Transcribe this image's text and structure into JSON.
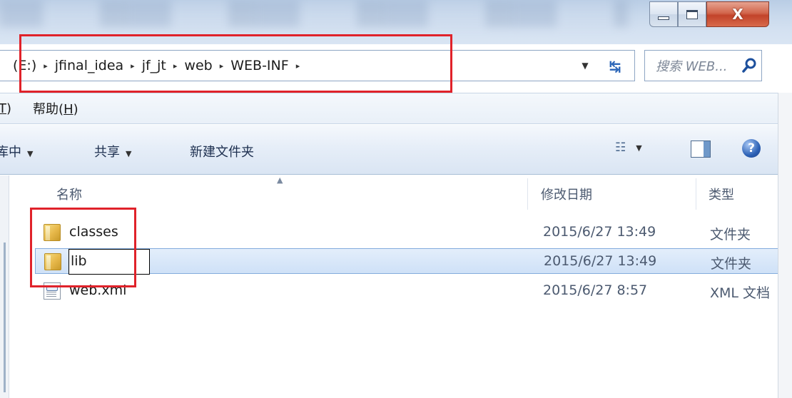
{
  "window": {
    "minimize_glyph": "",
    "close_glyph": "X"
  },
  "address": {
    "crumbs": [
      "(E:)",
      "jfinal_idea",
      "jf_jt",
      "web",
      "WEB-INF"
    ],
    "arrow": "▸",
    "dropdown_glyph": "▼",
    "refresh_glyph": "↹"
  },
  "search": {
    "placeholder": "搜索 WEB..."
  },
  "menu": {
    "items": [
      {
        "prefix": "",
        "underlined": "T",
        "suffix": ")"
      },
      {
        "prefix": "帮助(",
        "underlined": "H",
        "suffix": ")"
      }
    ]
  },
  "commands": {
    "include_library": "库中",
    "share": "共享",
    "new_folder": "新建文件夹",
    "dropdown_glyph": "▼",
    "view_glyph": "☷",
    "help_glyph": "?"
  },
  "columns": {
    "name": "名称",
    "date": "修改日期",
    "type": "类型",
    "sort_glyph": "▲"
  },
  "files": [
    {
      "name": "classes",
      "date": "2015/6/27 13:49",
      "type": "文件夹",
      "icon": "folder-icon",
      "selected": false,
      "renaming": false
    },
    {
      "name": "lib",
      "date": "2015/6/27 13:49",
      "type": "文件夹",
      "icon": "folder-icon",
      "selected": true,
      "renaming": true
    },
    {
      "name": "web.xml",
      "date": "2015/6/27 8:57",
      "type": "XML 文档",
      "icon": "xml-file-icon",
      "selected": false,
      "renaming": false
    }
  ],
  "colors": {
    "annotation_red": "#e0222a",
    "selection_border": "#84acdd",
    "accent_blue": "#2c66b8"
  }
}
